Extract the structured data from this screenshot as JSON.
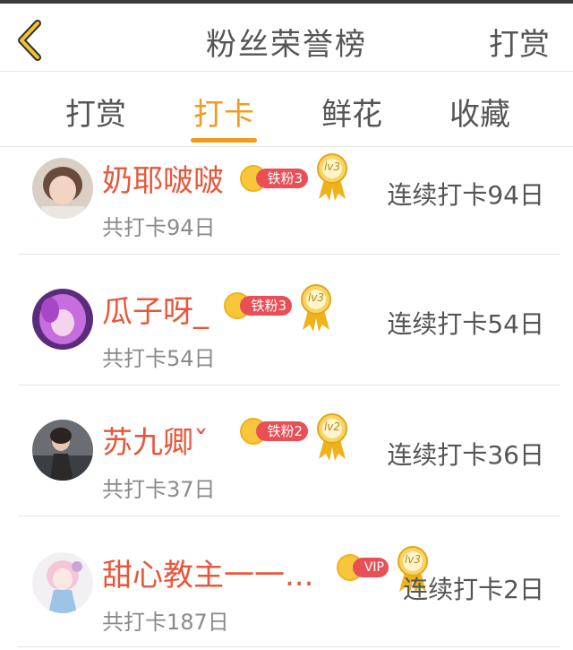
{
  "header": {
    "title": "粉丝荣誉榜",
    "right_action": "打赏",
    "back_icon": "chevron-left-icon",
    "accent_color": "#f29b1e"
  },
  "tabs": [
    {
      "label": "打赏",
      "active": false
    },
    {
      "label": "打卡",
      "active": true
    },
    {
      "label": "鲜花",
      "active": false
    },
    {
      "label": "收藏",
      "active": false
    }
  ],
  "rows": [
    {
      "name": "奶耶啵啵",
      "badge": "铁粉3",
      "level": "lv3",
      "total": "共打卡94日",
      "streak": "连续打卡94日"
    },
    {
      "name": "瓜子呀_",
      "badge": "铁粉3",
      "level": "lv3",
      "total": "共打卡54日",
      "streak": "连续打卡54日"
    },
    {
      "name": "苏九卿ˇ",
      "badge": "铁粉2",
      "level": "lv2",
      "total": "共打卡37日",
      "streak": "连续打卡36日"
    },
    {
      "name": "甜心教主一一...",
      "badge": "VIP",
      "level": "lv3",
      "total": "共打卡187日",
      "streak": "连续打卡2日"
    }
  ]
}
